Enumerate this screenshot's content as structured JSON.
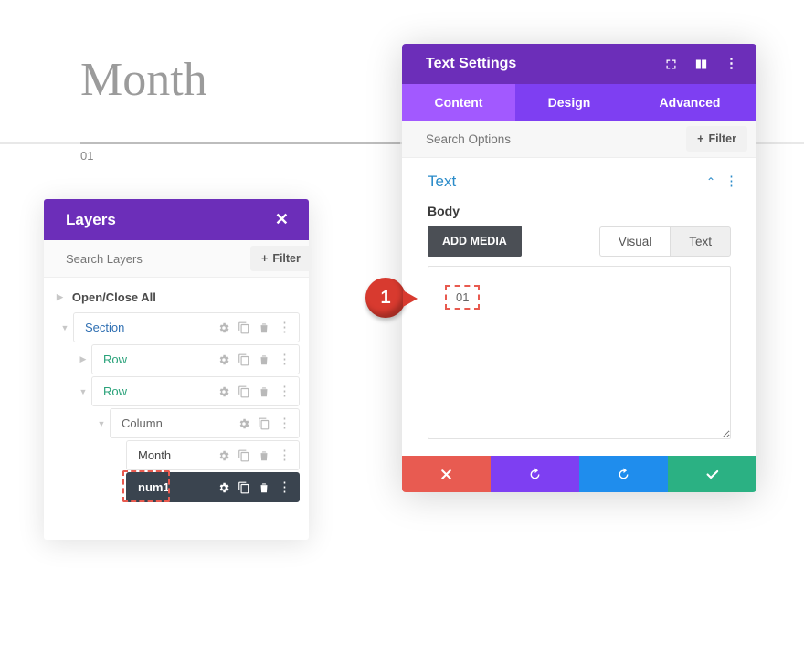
{
  "page": {
    "title": "Month",
    "num_label": "01"
  },
  "layers": {
    "title": "Layers",
    "search_placeholder": "Search Layers",
    "filter_label": "Filter",
    "open_close": "Open/Close All",
    "items": {
      "section": "Section",
      "row1": "Row",
      "row2": "Row",
      "column": "Column",
      "month": "Month",
      "num1": "num1"
    }
  },
  "settings": {
    "title": "Text Settings",
    "tabs": {
      "content": "Content",
      "design": "Design",
      "advanced": "Advanced"
    },
    "search_placeholder": "Search Options",
    "filter_label": "Filter",
    "section_title": "Text",
    "body_label": "Body",
    "add_media": "ADD MEDIA",
    "visual": "Visual",
    "text": "Text",
    "editor_value": "01"
  },
  "pointer": {
    "label": "1"
  }
}
